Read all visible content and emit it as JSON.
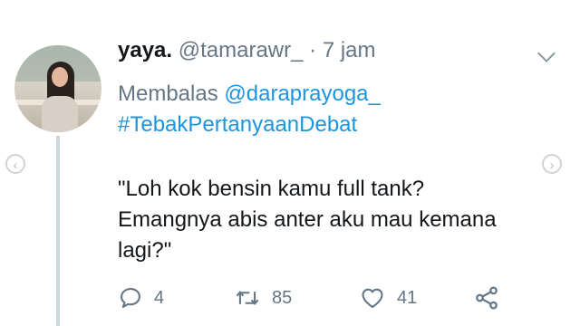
{
  "tweet": {
    "display_name": "yaya.",
    "handle": "@tamarawr_",
    "separator": "·",
    "time": "7 jam",
    "reply_prefix": "Membalas",
    "reply_to": "@daraprayoga_",
    "hashtag": "#TebakPertanyaanDebat",
    "text_lines": [
      "\"Loh kok bensin kamu full tank?",
      "Emangnya abis anter aku mau kemana",
      "lagi?\""
    ]
  },
  "actions": {
    "reply_count": "4",
    "retweet_count": "85",
    "like_count": "41"
  },
  "icons": {
    "reply": "reply-icon",
    "retweet": "retweet-icon",
    "like": "heart-icon",
    "share": "share-icon",
    "menu": "chevron-down-icon",
    "prev": "chevron-left-icon",
    "next": "chevron-right-icon"
  },
  "colors": {
    "link": "#1b95e0",
    "secondary_text": "#657786",
    "primary_text": "#14171a",
    "thread_line": "#ccd6dd"
  }
}
